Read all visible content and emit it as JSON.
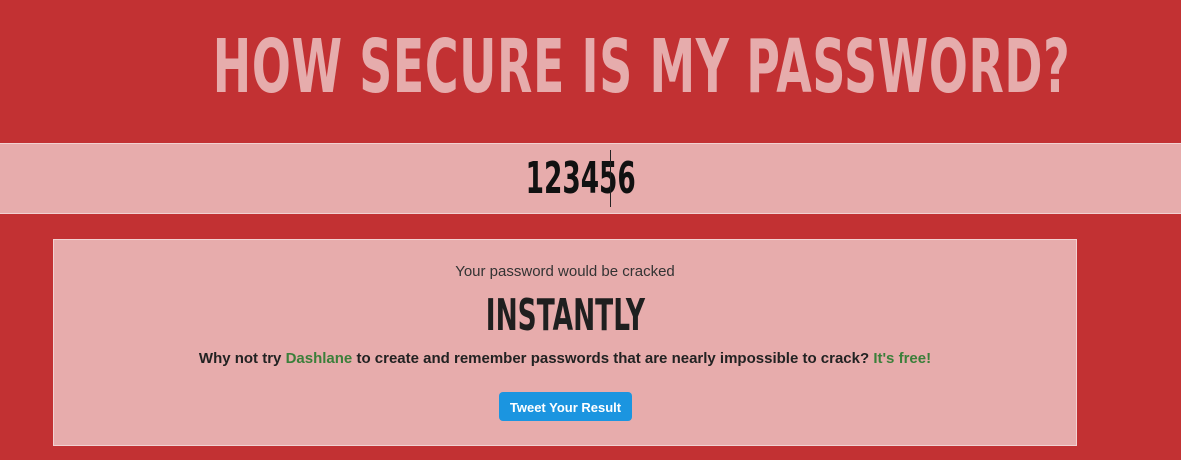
{
  "header": {
    "title": "HOW SECURE IS MY PASSWORD?"
  },
  "password_field": {
    "value": "123456"
  },
  "result": {
    "cracked_label": "Your password would be cracked",
    "time": "INSTANTLY",
    "promo_prefix": "Why not try",
    "promo_link": "Dashlane",
    "promo_middle": "to create and remember passwords that are nearly impossible to crack?",
    "promo_free": "It's free!",
    "tweet_button": "Tweet Your Result"
  },
  "colors": {
    "background": "#c23133",
    "panel": "#e7acac",
    "title": "#e6acac",
    "link": "#3b7f3a",
    "tweet": "#1b95e0"
  }
}
